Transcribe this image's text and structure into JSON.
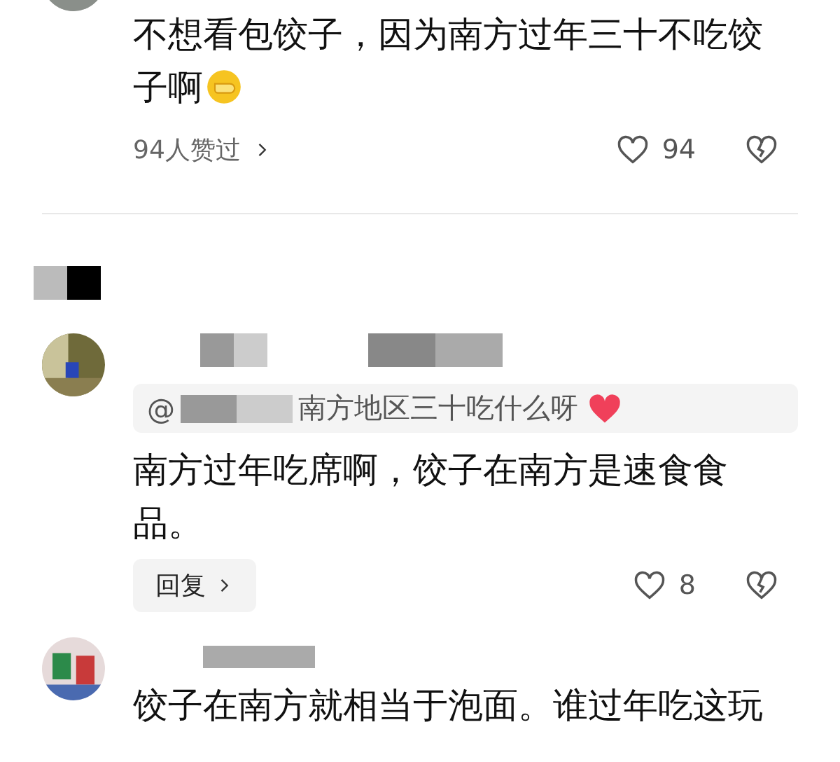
{
  "comments": [
    {
      "text": "不想看包饺子，因为南方过年三十不吃饺子啊",
      "likers": "94人赞过",
      "likes": "94"
    },
    {
      "quote": {
        "prefix": "@",
        "text": "南方地区三十吃什么呀"
      },
      "text": "南方过年吃席啊，饺子在南方是速食食品。",
      "reply_button": "回复",
      "likes": "8"
    },
    {
      "text": "饺子在南方就相当于泡面。谁过年吃这玩"
    }
  ]
}
